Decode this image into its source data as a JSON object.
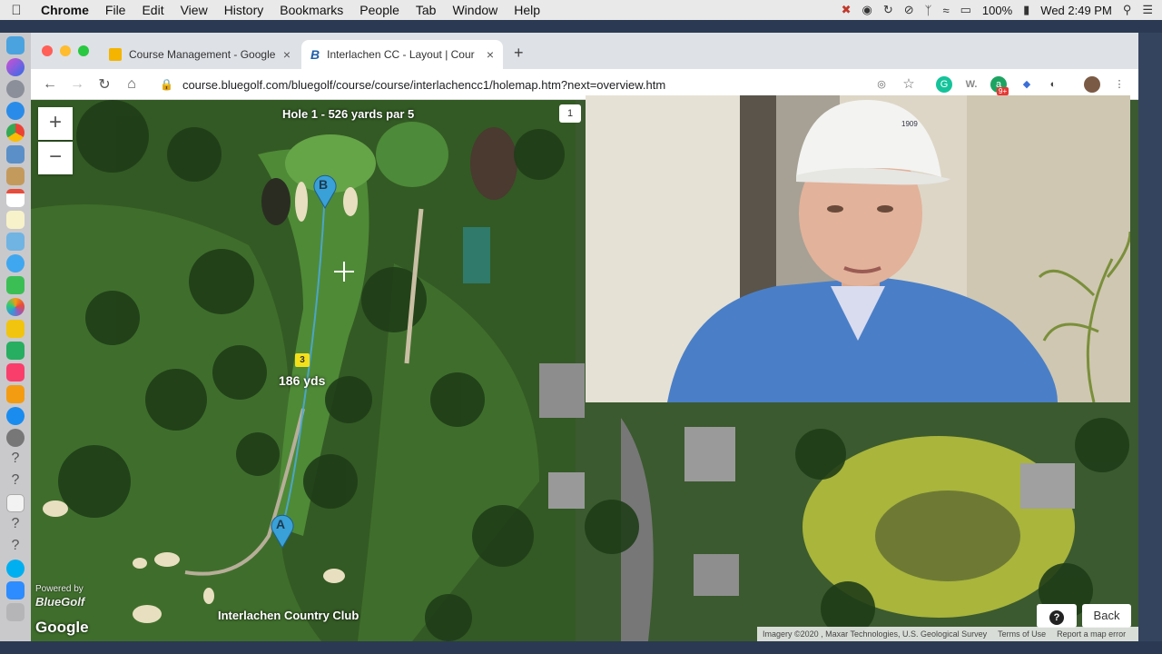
{
  "menubar": {
    "app_name": "Chrome",
    "menus": [
      "File",
      "Edit",
      "View",
      "History",
      "Bookmarks",
      "People",
      "Tab",
      "Window",
      "Help"
    ],
    "battery": "100%",
    "clock": "Wed 2:49 PM"
  },
  "tabs": [
    {
      "title": "Course Management - Google"
    },
    {
      "title": "Interlachen CC - Layout | Cour"
    }
  ],
  "toolbar": {
    "url": "course.bluegolf.com/bluegolf/course/course/interlachencc1/holemap.htm?next=overview.htm",
    "ext_badge": "9+"
  },
  "map": {
    "zoom_in": "+",
    "zoom_out": "−",
    "hole_title": "Hole 1 - 526 yards par 5",
    "page_chip": "1",
    "marker_a": "A",
    "marker_b": "B",
    "marker_3": "3",
    "distance": "186 yds",
    "club_label": "Interlachen Country Club",
    "powered_by": "Powered by",
    "brand": "BlueGolf",
    "google": "Google",
    "attribution": "Imagery ©2020 , Maxar Technologies, U.S. Geological Survey",
    "terms": "Terms of Use",
    "report": "Report a map error",
    "help": "?",
    "back": "Back"
  },
  "video": {
    "cap_logo_text": "1909"
  },
  "colors": {
    "fairway": "#4f8a37",
    "rough": "#335a24",
    "trees": "#1f3d18",
    "water": "#4a3a30",
    "line": "#4aa9d6",
    "marker": "#3aa0d8",
    "shirt": "#4a7fc7",
    "cap": "#f3f3f1"
  }
}
